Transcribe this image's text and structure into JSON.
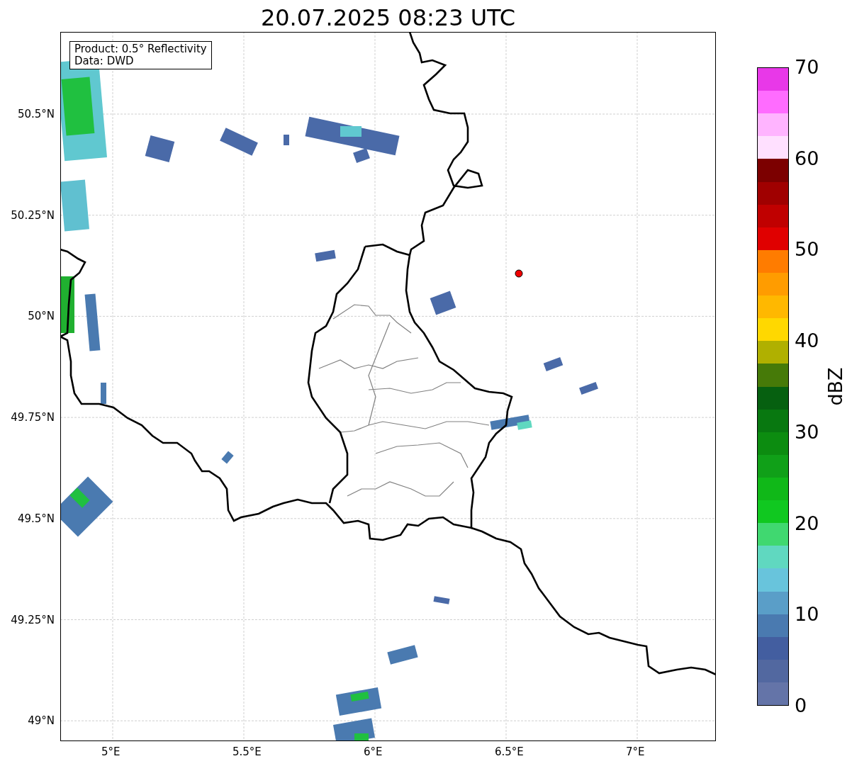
{
  "title": "20.07.2025 08:23 UTC",
  "legend": {
    "lines": [
      "Product: 0.5° Reflectivity",
      "Data: DWD"
    ]
  },
  "x_ticks": [
    "5°E",
    "5.5°E",
    "6°E",
    "6.5°E",
    "7°E"
  ],
  "y_ticks": [
    "50.5°N",
    "50.25°N",
    "50°N",
    "49.75°N",
    "49.5°N",
    "49.25°N",
    "49°N"
  ],
  "colorbar": {
    "label": "dBZ",
    "ticks": [
      "70",
      "60",
      "50",
      "40",
      "30",
      "20",
      "10",
      "0"
    ],
    "bins": [
      {
        "color": "#e838e8"
      },
      {
        "color": "#ff6cff"
      },
      {
        "color": "#ffb4ff"
      },
      {
        "color": "#ffe0ff"
      },
      {
        "color": "#7c0000"
      },
      {
        "color": "#a00000"
      },
      {
        "color": "#c00000"
      },
      {
        "color": "#e00000"
      },
      {
        "color": "#ff7c00"
      },
      {
        "color": "#ff9c00"
      },
      {
        "color": "#ffb800"
      },
      {
        "color": "#ffd800"
      },
      {
        "color": "#b0b000"
      },
      {
        "color": "#467a08"
      },
      {
        "color": "#066010"
      },
      {
        "color": "#087810"
      },
      {
        "color": "#0c8c10"
      },
      {
        "color": "#10a018"
      },
      {
        "color": "#10b818"
      },
      {
        "color": "#10c820"
      },
      {
        "color": "#40d870"
      },
      {
        "color": "#60d8c0"
      },
      {
        "color": "#68c4dc"
      },
      {
        "color": "#5a9ec8"
      },
      {
        "color": "#4a7ab0"
      },
      {
        "color": "#435ea0"
      },
      {
        "color": "#5268a0"
      },
      {
        "color": "#6474a8"
      }
    ]
  }
}
